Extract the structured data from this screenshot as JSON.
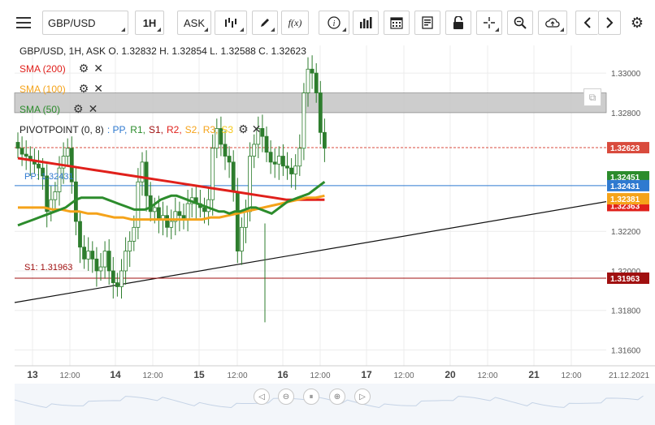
{
  "toolbar": {
    "symbol": "GBP/USD",
    "timeframe": "1H",
    "price_type": "ASK",
    "fx_label": "f(x)"
  },
  "legend": {
    "title": "GBP/USD, 1H, ASK   O. 1.32832 H. 1.32854 L. 1.32588 C. 1.32623",
    "sma200": "SMA (200)",
    "sma100": "SMA (100)",
    "sma50": "SMA (50)",
    "pivot_label": "PIVOTPOINT (0, 8)",
    "pivot_items": [
      ": PP,",
      "R1,",
      "S1,",
      "R2,",
      "S2,",
      "R3,",
      "S3"
    ],
    "pp_label": "PP: 1.32431",
    "s1_label": "S1: 1.31963"
  },
  "colors": {
    "sma200": "#e0201b",
    "sma100": "#f5a31a",
    "sma50": "#2c8c2c",
    "pp": "#2f7ad0",
    "s1": "#a01010",
    "current": "#d94b3d",
    "candle": "#2d7d2d",
    "band": "#c8c8c8"
  },
  "axis": {
    "price_ticks": [
      "1.33000",
      "1.32800",
      "1.32200",
      "1.32000",
      "1.31800",
      "1.31600"
    ],
    "time_ticks": [
      "13",
      "12:00",
      "14",
      "12:00",
      "15",
      "12:00",
      "16",
      "12:00",
      "17",
      "12:00",
      "20",
      "12:00",
      "21",
      "12:00",
      "21.12.2021"
    ],
    "current_price": "1.32623",
    "badge_pp": "1.32431",
    "badge_s1": "1.31963",
    "badge_sma50": "1.32451",
    "badge_sma100": "1.32381",
    "badge_sma200": "1.32363"
  },
  "chart_data": {
    "type": "line",
    "title": "GBP/USD, 1H, ASK",
    "ohlc_last": {
      "open": 1.32832,
      "high": 1.32854,
      "low": 1.32588,
      "close": 1.32623
    },
    "ylim": [
      1.3152,
      1.3314
    ],
    "x": [
      0,
      1,
      2,
      3,
      4,
      5,
      6,
      7,
      8,
      9,
      10,
      11,
      12,
      13,
      14,
      15,
      16,
      17,
      18,
      19,
      20,
      21,
      22,
      23,
      24,
      25,
      26,
      27,
      28,
      29,
      30,
      31,
      32,
      33,
      34,
      35,
      36,
      37,
      38,
      39,
      40,
      41,
      42,
      43,
      44,
      45,
      46,
      47,
      48,
      49,
      50,
      51,
      52,
      53,
      54,
      55,
      56,
      57,
      58,
      59,
      60,
      61,
      62,
      63,
      64,
      65,
      66,
      67,
      68,
      69,
      70,
      71,
      72,
      73,
      74,
      75,
      76
    ],
    "close": [
      1.3262,
      1.3259,
      1.3258,
      1.3256,
      1.3254,
      1.3252,
      1.3248,
      1.323,
      1.3236,
      1.324,
      1.3252,
      1.3258,
      1.3262,
      1.3245,
      1.3225,
      1.3212,
      1.3206,
      1.321,
      1.3206,
      1.32,
      1.3202,
      1.321,
      1.32,
      1.3194,
      1.3192,
      1.32,
      1.321,
      1.3215,
      1.3222,
      1.3245,
      1.3255,
      1.3238,
      1.323,
      1.3232,
      1.3226,
      1.3228,
      1.3222,
      1.3225,
      1.323,
      1.3228,
      1.3226,
      1.3234,
      1.3237,
      1.3234,
      1.3232,
      1.323,
      1.3236,
      1.3262,
      1.3272,
      1.3264,
      1.3258,
      1.3255,
      1.324,
      1.321,
      1.3222,
      1.323,
      1.3258,
      1.3264,
      1.3272,
      1.3268,
      1.326,
      1.3255,
      1.3254,
      1.3258,
      1.3253,
      1.3252,
      1.3249,
      1.3253,
      1.3262,
      1.329,
      1.3302,
      1.33,
      1.329,
      1.327,
      1.3262
    ],
    "sma50": [
      1.3223,
      1.3224,
      1.3225,
      1.3226,
      1.3227,
      1.3228,
      1.3229,
      1.323,
      1.3231,
      1.3232,
      1.3234,
      1.3236,
      1.3237,
      1.3237,
      1.3237,
      1.3237,
      1.3237,
      1.3236,
      1.3235,
      1.3234,
      1.3233,
      1.3232,
      1.3231,
      1.3231,
      1.3231,
      1.3232,
      1.3234,
      1.3236,
      1.3237,
      1.3238,
      1.3238,
      1.3237,
      1.3236,
      1.3235,
      1.3234,
      1.3233,
      1.3232,
      1.3231,
      1.323,
      1.323,
      1.3229,
      1.323,
      1.323,
      1.3231,
      1.3232,
      1.3232,
      1.3231,
      1.323,
      1.3229,
      1.3231,
      1.3233,
      1.3235,
      1.3236,
      1.3237,
      1.3238,
      1.3239,
      1.3241,
      1.3243,
      1.3245
    ],
    "sma100": [
      1.3232,
      1.3232,
      1.3232,
      1.3232,
      1.3231,
      1.3231,
      1.323,
      1.323,
      1.3229,
      1.3229,
      1.3228,
      1.3227,
      1.3227,
      1.3226,
      1.3226,
      1.3226,
      1.3226,
      1.3226,
      1.3226,
      1.3226,
      1.3226,
      1.3226,
      1.3227,
      1.3227,
      1.3228,
      1.3229,
      1.323,
      1.3231,
      1.3232,
      1.3233,
      1.3234,
      1.3235,
      1.3236,
      1.3237,
      1.3237,
      1.3238
    ],
    "sma200": [
      1.3257,
      1.3256,
      1.3255,
      1.3254,
      1.3253,
      1.3252,
      1.3251,
      1.325,
      1.3249,
      1.3248,
      1.3247,
      1.3246,
      1.3245,
      1.3244,
      1.3243,
      1.3242,
      1.3241,
      1.324,
      1.3239,
      1.3238,
      1.3237,
      1.3236,
      1.3236,
      1.3236,
      1.3236
    ],
    "pivot_pp": 1.32431,
    "pivot_s1": 1.31963,
    "resistance_band": [
      1.328,
      1.329
    ]
  }
}
